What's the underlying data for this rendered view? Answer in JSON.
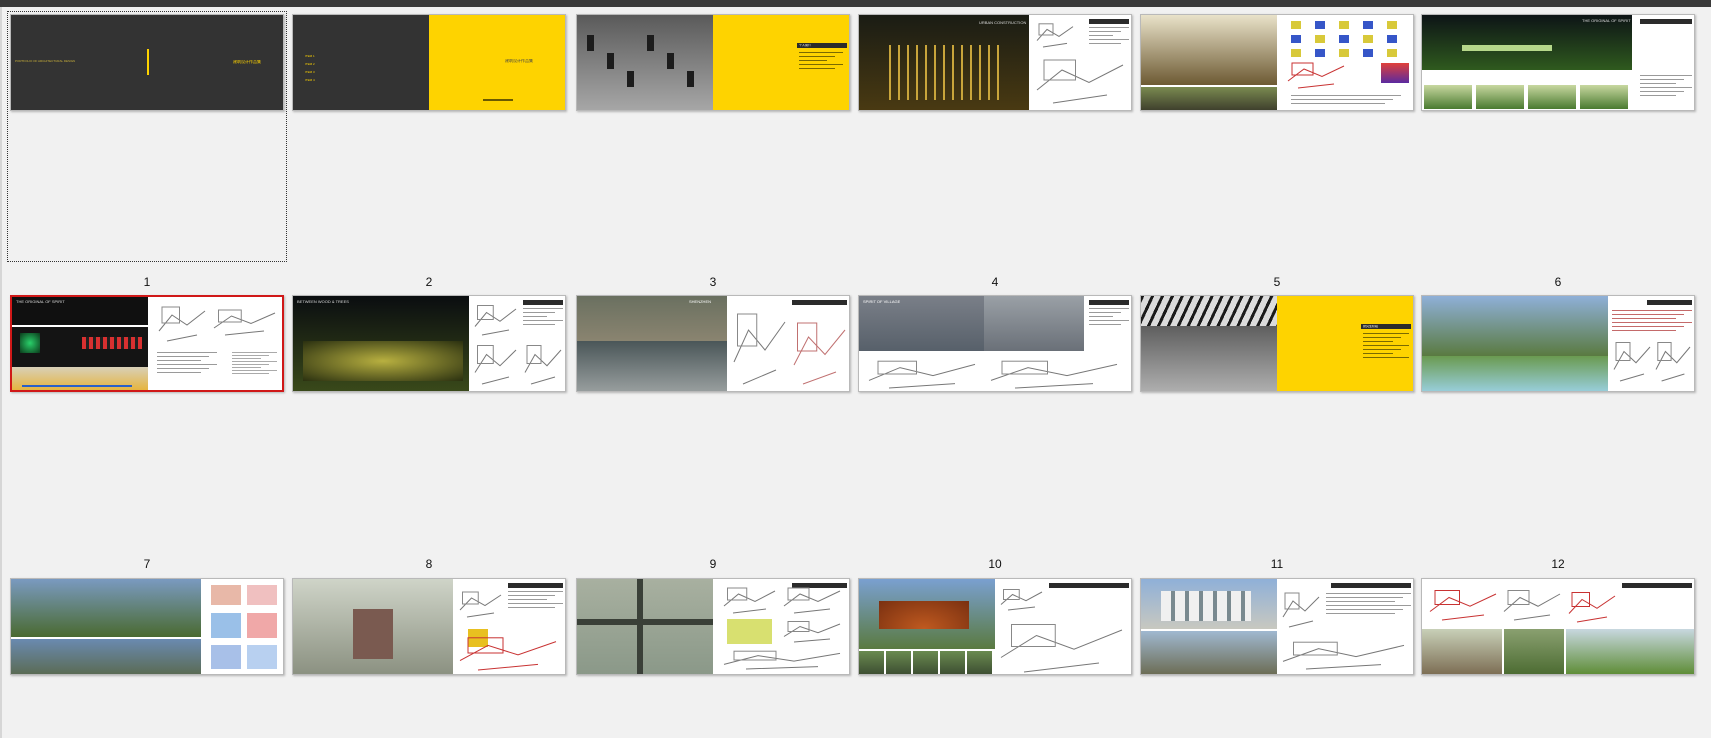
{
  "window": {
    "title": ""
  },
  "page_thumbnails": [
    {
      "number": "1",
      "selected": true,
      "title_left": "PORTFOLIO OF ARCHITECTURAL DESIGN",
      "title_right": "建筑设计作品集",
      "style": "dark-cover"
    },
    {
      "number": "2",
      "selected": false,
      "menu": [
        "ITEM 1",
        "ITEM 2",
        "ITEM 3",
        "ITEM 4"
      ],
      "title_right": "建筑设计作品集",
      "style": "dark-yellow"
    },
    {
      "number": "3",
      "selected": false,
      "heading": "个人简介",
      "style": "photo-yellow"
    },
    {
      "number": "4",
      "selected": false,
      "heading": "URBAN CONSTRUCTION",
      "style": "night-render"
    },
    {
      "number": "5",
      "selected": false,
      "style": "render-diagrams"
    },
    {
      "number": "6",
      "selected": false,
      "heading": "THE ORIGINAL OF SPIRIT",
      "style": "landscape"
    },
    {
      "number": "7",
      "selected": false,
      "heading": "THE ORIGINAL OF SPIRIT",
      "style": "sections",
      "active": true
    },
    {
      "number": "8",
      "selected": false,
      "heading": "BETWEEN WOOD & TREES",
      "style": "forest"
    },
    {
      "number": "9",
      "selected": false,
      "heading": "SHENZHEN",
      "style": "aerial"
    },
    {
      "number": "10",
      "selected": false,
      "heading": "SPIRIT OF VILLAGE",
      "style": "village"
    },
    {
      "number": "11",
      "selected": false,
      "heading": "研究生阶段",
      "style": "bw-yellow"
    },
    {
      "number": "12",
      "selected": false,
      "style": "campus"
    },
    {
      "number": "",
      "selected": false,
      "style": "panorama"
    },
    {
      "number": "",
      "selected": false,
      "style": "city-aerial"
    },
    {
      "number": "",
      "selected": false,
      "style": "site-plan"
    },
    {
      "number": "",
      "selected": false,
      "style": "dome"
    },
    {
      "number": "",
      "selected": false,
      "style": "gate"
    },
    {
      "number": "",
      "selected": false,
      "style": "resort"
    }
  ],
  "colors": {
    "background": "#f1f1f1",
    "dark_page": "#333333",
    "accent_yellow": "#fed300",
    "selection_red": "#d01818",
    "diagram_red": "#c83232"
  }
}
